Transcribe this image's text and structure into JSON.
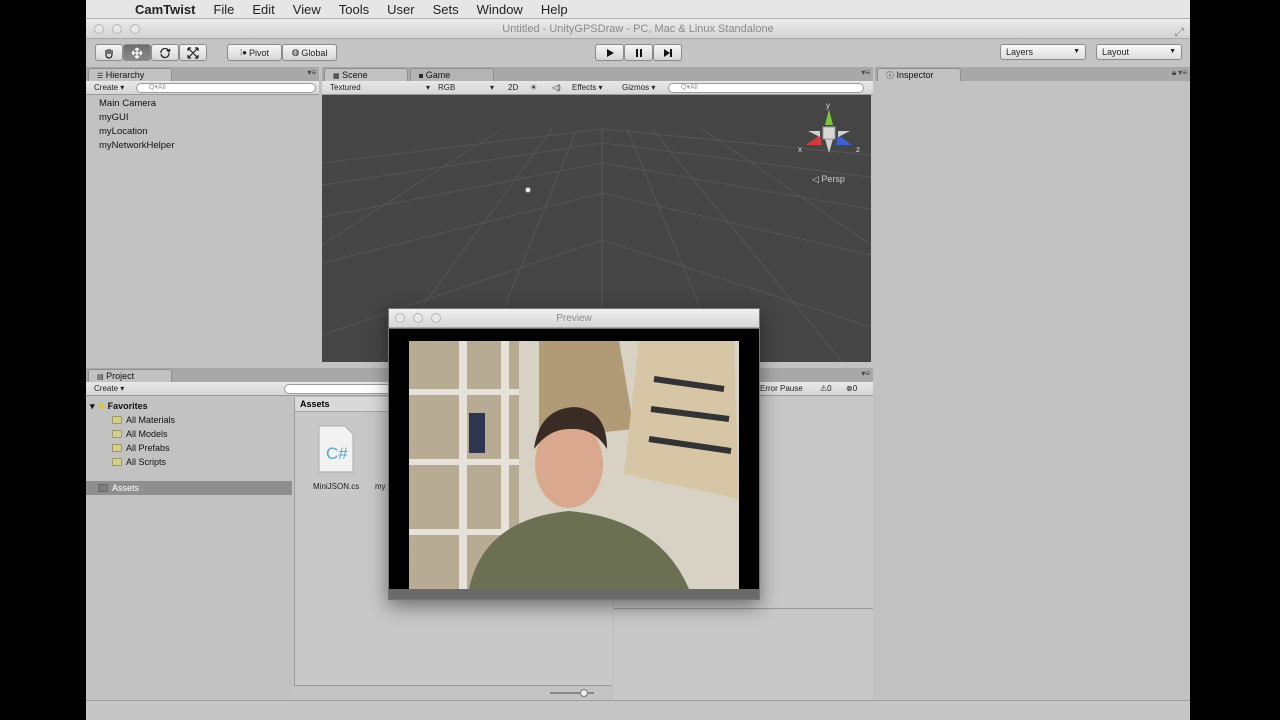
{
  "menubar": {
    "apple": "",
    "items": [
      "CamTwist",
      "File",
      "Edit",
      "View",
      "Tools",
      "User",
      "Sets",
      "Window",
      "Help"
    ]
  },
  "window": {
    "title": "Untitled - UnityGPSDraw - PC, Mac & Linux Standalone"
  },
  "toolbar": {
    "pivot_label": "Pivot",
    "global_label": "Global",
    "layers_label": "Layers",
    "layout_label": "Layout"
  },
  "hierarchy": {
    "tab": "Hierarchy",
    "create_label": "Create",
    "search_placeholder": "Q▾All",
    "items": [
      "Main Camera",
      "myGUI",
      "myLocation",
      "myNetworkHelper"
    ]
  },
  "scene": {
    "tabs": [
      "Scene",
      "Game"
    ],
    "shading": "Textured",
    "render_mode": "RGB",
    "toggle_2d": "2D",
    "effects": "Effects",
    "gizmos": "Gizmos",
    "search_placeholder": "Q▾All",
    "persp_label": "Persp",
    "axes": {
      "y": "y",
      "x": "x",
      "z": "z"
    }
  },
  "inspector": {
    "tab": "Inspector"
  },
  "project": {
    "tab": "Project",
    "create_label": "Create",
    "favorites_label": "Favorites",
    "favorites": [
      "All Materials",
      "All Models",
      "All Prefabs",
      "All Scripts"
    ],
    "assets_root": "Assets",
    "breadcrumb": "Assets",
    "files": [
      "MiniJSON.cs",
      "my"
    ]
  },
  "console": {
    "error_pause": "Error Pause",
    "warn_count": "0",
    "error_count": "0"
  },
  "preview_window": {
    "title": "Preview"
  },
  "colors": {
    "editor_bg": "#c2c2c2",
    "scene_bg": "#454545",
    "axis_y": "#7ec43b",
    "axis_x": "#d23b3b",
    "axis_z": "#3b62d2"
  }
}
